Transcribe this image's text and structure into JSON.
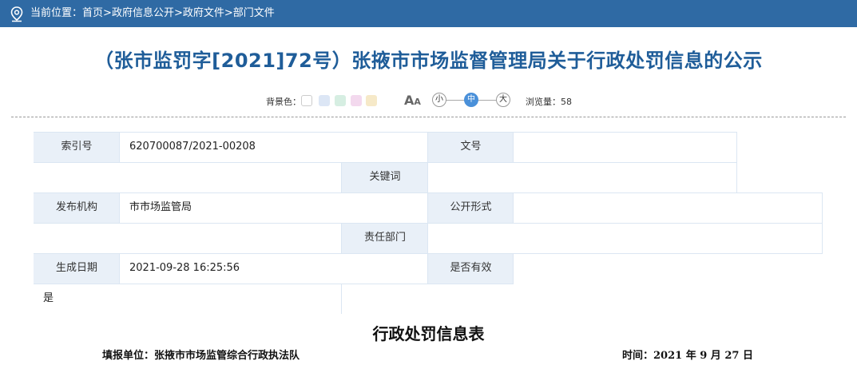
{
  "breadcrumb": {
    "prefix": "当前位置：",
    "items": [
      "首页",
      "政府信息公开",
      "政府文件",
      "部门文件"
    ],
    "separator": ">"
  },
  "title": "（张市监罚字[2021]72号）张掖市市场监督管理局关于行政处罚信息的公示",
  "toolbar": {
    "bg_label": "背景色：",
    "bg_colors": [
      "#ffffff",
      "#dce6f5",
      "#d6eee2",
      "#f3d9ee",
      "#f6e9c8"
    ],
    "font_icon": "font-size-icon",
    "sizes": [
      "小",
      "中",
      "大"
    ],
    "active_size": "中",
    "views_label": "浏览量：58"
  },
  "meta": {
    "index_label": "索引号",
    "index_value": "620700087/2021-00208",
    "docno_label": "文号",
    "docno_value": "",
    "keyword_label": "关键词",
    "keyword_value": "",
    "publisher_label": "发布机构",
    "publisher_value": "市市场监管局",
    "form_label": "公开形式",
    "form_value": "",
    "dept_label": "责任部门",
    "dept_value": "",
    "date_label": "生成日期",
    "date_value": "2021-09-28 16:25:56",
    "valid_label": "是否有效",
    "valid_value": "是"
  },
  "document": {
    "heading": "行政处罚信息表",
    "unit": "填报单位：张掖市市场监管综合行政执法队",
    "date": "时间：2021 年 9 月 27 日"
  }
}
